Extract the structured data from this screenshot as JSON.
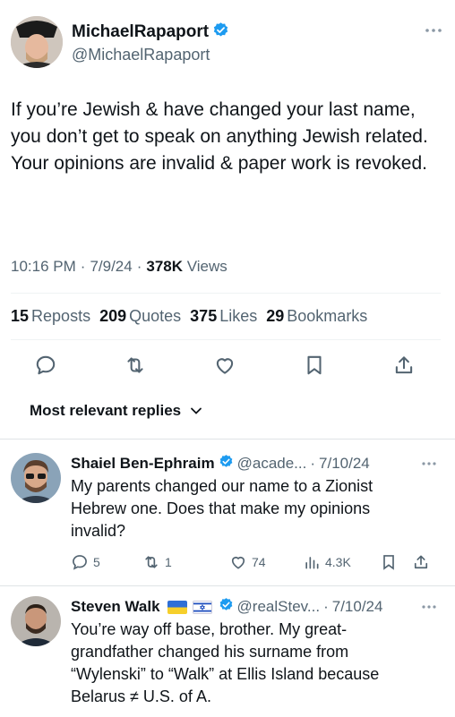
{
  "tweet": {
    "author_name": "MichaelRapaport",
    "author_handle": "@MichaelRapaport",
    "text": "If you’re Jewish & have changed your last name, you don’t get to speak on anything Jewish related.\nYour opinions are invalid & paper work is revoked.",
    "time": "10:16 PM",
    "date": "7/9/24",
    "views_count": "378K",
    "views_label": "Views",
    "stats": {
      "reposts_count": "15",
      "reposts_label": "Reposts",
      "quotes_count": "209",
      "quotes_label": "Quotes",
      "likes_count": "375",
      "likes_label": "Likes",
      "bookmarks_count": "29",
      "bookmarks_label": "Bookmarks"
    }
  },
  "actions": [
    "reply-icon",
    "repost-icon",
    "like-icon",
    "bookmark-icon",
    "share-icon"
  ],
  "sort_label": "Most relevant replies",
  "replies": [
    {
      "name": "Shaiel Ben-Ephraim",
      "handle": "@acade...",
      "date": "7/10/24",
      "text": "My parents changed our name to a Zionist\nHebrew one. Does that make my opinions\ninvalid?",
      "reply_count": "5",
      "repost_count": "1",
      "like_count": "74",
      "view_count": "4.3K"
    },
    {
      "name": "Steven Walk",
      "handle": "@realStev...",
      "date": "7/10/24",
      "text": "You’re way off base, brother. My great-\ngrandfather changed his surname from\n“Wylenski” to “Walk” at Ellis Island because\nBelarus ≠ U.S. of A."
    }
  ],
  "colors": {
    "accent": "#1d9bf0",
    "secondary_text": "#536471",
    "divider": "#eff3f4"
  }
}
